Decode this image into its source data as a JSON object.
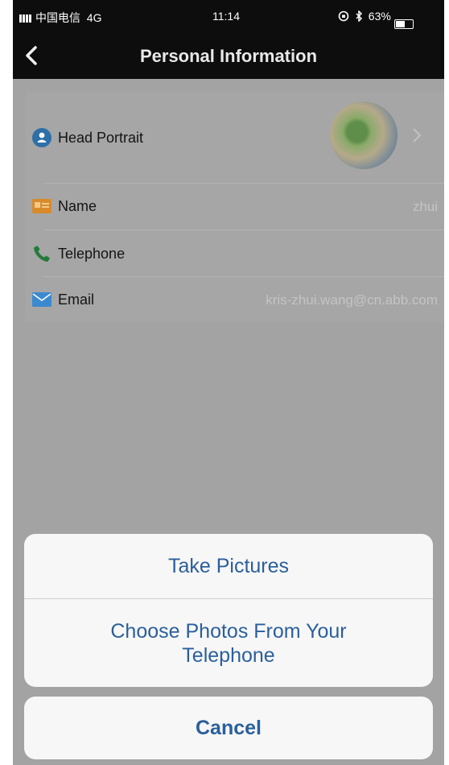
{
  "status_bar": {
    "carrier": "中国电信",
    "network": "4G",
    "time": "11:14",
    "battery_percent": "63%",
    "battery_level": 0.63,
    "icons": [
      "signal-icon",
      "orientation-lock-icon",
      "bluetooth-icon",
      "battery-icon"
    ]
  },
  "nav_bar": {
    "title": "Personal Information",
    "back_icon": "chevron-left-icon"
  },
  "profile": {
    "rows": [
      {
        "label": "Head Portrait",
        "icon": "user-icon",
        "value": ""
      },
      {
        "label": "Name",
        "icon": "id-card-icon",
        "value": "zhui"
      },
      {
        "label": "Telephone",
        "icon": "phone-icon",
        "value": ""
      },
      {
        "label": "Email",
        "icon": "mail-icon",
        "value": "kris-zhui.wang@cn.abb.com"
      }
    ]
  },
  "action_sheet": {
    "options": [
      "Take Pictures",
      "Choose Photos From Your Telephone"
    ],
    "cancel_label": "Cancel"
  },
  "colors": {
    "nav_background": "#0d0d0d",
    "overlay": "#a3a3a3",
    "action_text": "#2a5f9c",
    "user_icon": "#2e6fa8",
    "phone_icon": "#237b3a",
    "mail_icon": "#3b8ad0",
    "id_card_icon": "#d98b2b"
  }
}
